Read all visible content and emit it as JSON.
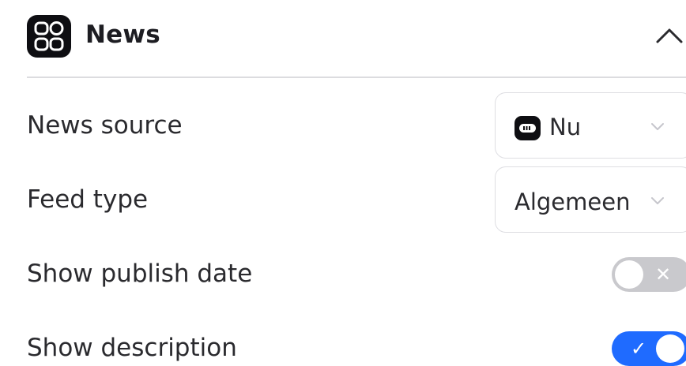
{
  "header": {
    "title": "News",
    "app_icon": "grid-apps-icon",
    "collapse_icon": "chevron-up-icon"
  },
  "settings": {
    "news_source": {
      "label": "News source",
      "value": "Nu",
      "source_icon": "nu-logo-icon"
    },
    "feed_type": {
      "label": "Feed type",
      "value": "Algemeen"
    },
    "show_publish_date": {
      "label": "Show publish date",
      "enabled": false
    },
    "show_description": {
      "label": "Show description",
      "enabled": true
    }
  },
  "colors": {
    "toggle_on": "#1f6bff",
    "toggle_off": "#c9c9cd",
    "icon_bg": "#0e0e12"
  }
}
